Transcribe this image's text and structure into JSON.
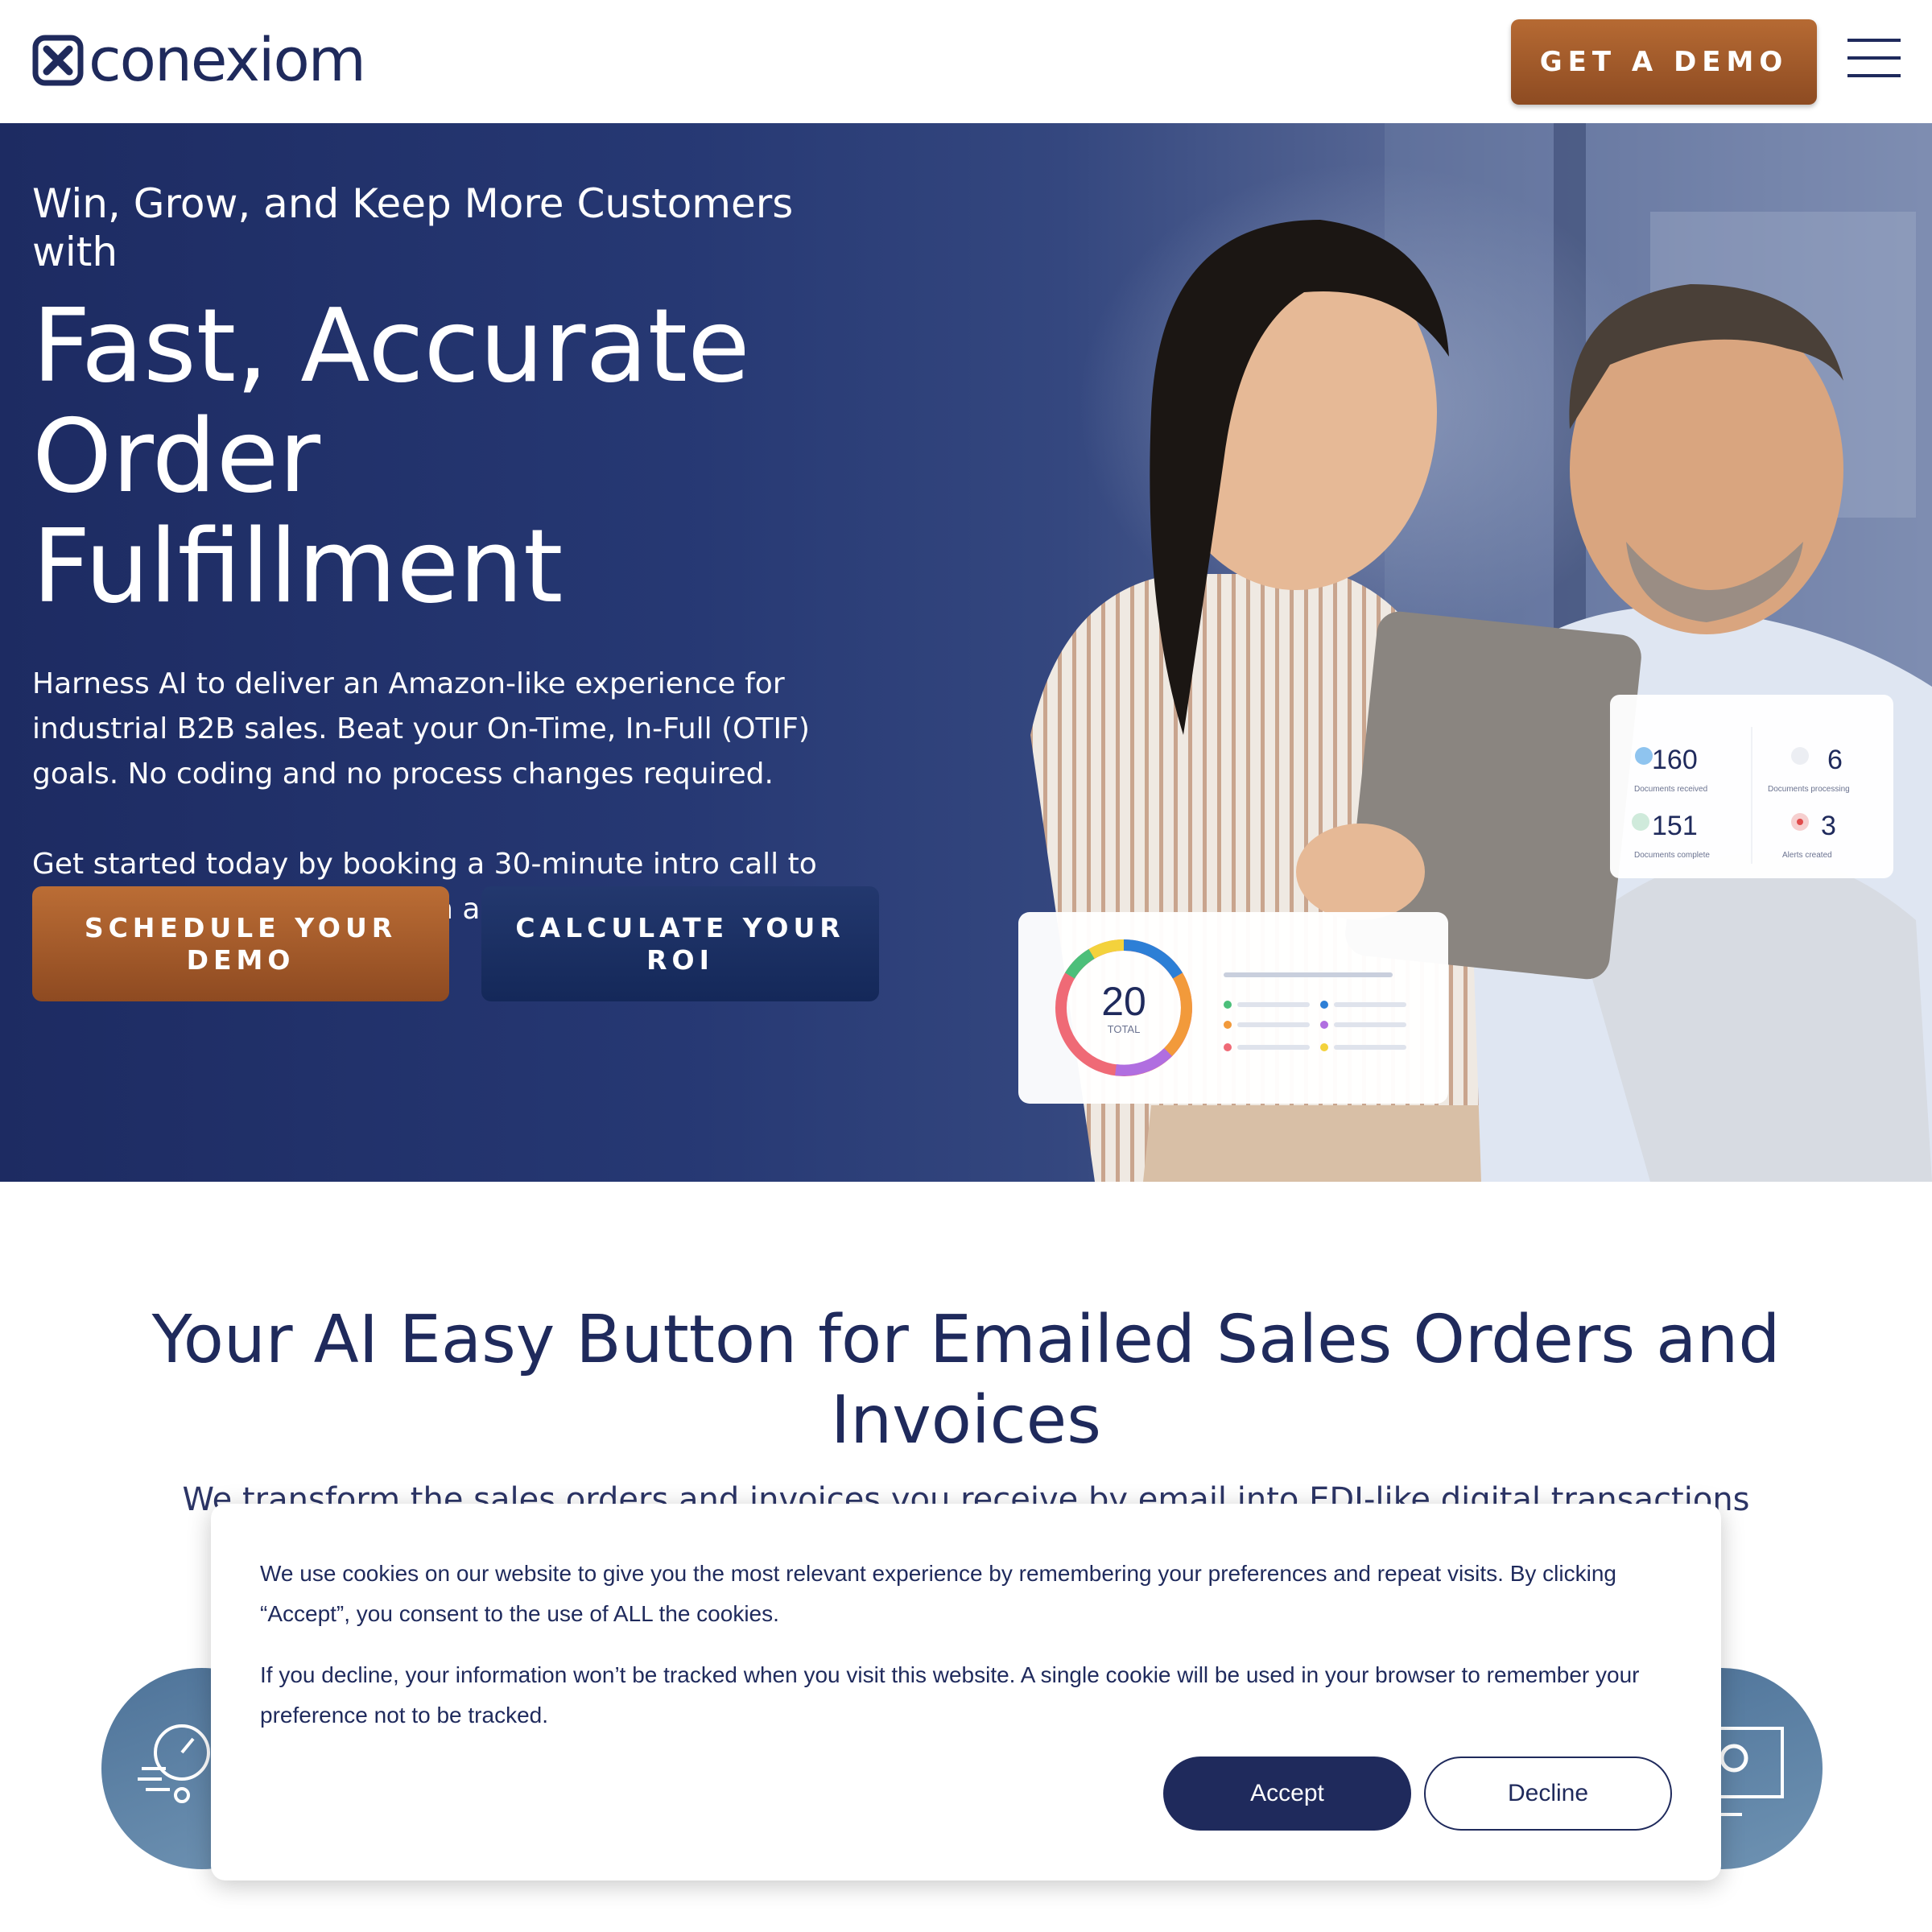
{
  "header": {
    "logo_text": "conexiom",
    "demo_button": "GET A DEMO"
  },
  "hero": {
    "kicker": "Win, Grow, and Keep More Customers with",
    "headline_line1": "Fast, Accurate",
    "headline_line2": "Order",
    "headline_line3": "Fulfillment",
    "body1": "Harness AI to deliver an Amazon-like experience for industrial B2B sales. Beat your On-Time, In-Full (OTIF) goals. No coding and no process changes required.",
    "body2": "Get started today by booking a 30-minute intro call to discover how much AI-driven automation could benefit your business.",
    "button_schedule": "SCHEDULE YOUR DEMO",
    "button_roi": "CALCULATE YOUR ROI",
    "stats_card": {
      "stat1_value": "160",
      "stat1_label": "Documents received",
      "stat2_value": "6",
      "stat2_label": "Documents processing",
      "stat3_value": "151",
      "stat3_label": "Documents complete",
      "stat4_value": "3",
      "stat4_label": "Alerts created"
    },
    "donut_card": {
      "total_value": "20",
      "total_label": "TOTAL"
    }
  },
  "section": {
    "title": "Your AI Easy Button for Emailed Sales Orders and Invoices",
    "subtitle": "We transform the sales orders and invoices you receive by email into EDI-like digital transactions"
  },
  "cookie": {
    "paragraph1": "We use cookies on our website to give you the most relevant experience by remembering your preferences and repeat visits. By clicking “Accept”, you consent to the use of ALL the cookies.",
    "paragraph2": "If you decline, your information won’t be tracked when you visit this website. A single cookie will be used in your browser to remember your preference not to be tracked.",
    "accept": "Accept",
    "decline": "Decline"
  },
  "colors": {
    "navy": "#1f2a5c",
    "copper": "#a85c2b",
    "hero_blue": "#263873"
  }
}
